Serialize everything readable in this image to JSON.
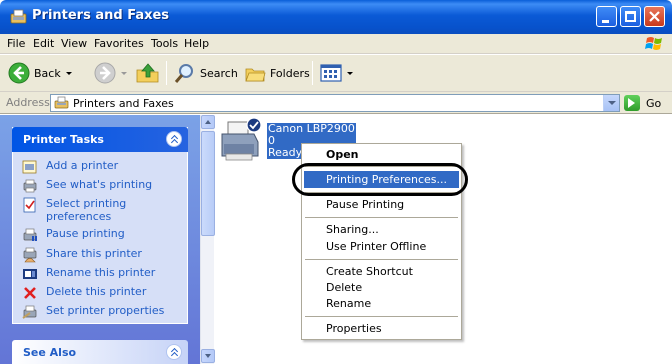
{
  "window": {
    "title": "Printers and Faxes"
  },
  "menubar": {
    "items": [
      "File",
      "Edit",
      "View",
      "Favorites",
      "Tools",
      "Help"
    ]
  },
  "toolbar": {
    "back_label": "Back",
    "search_label": "Search",
    "folders_label": "Folders"
  },
  "address": {
    "label": "Address",
    "value": "Printers and Faxes",
    "go_label": "Go"
  },
  "tasks": {
    "title": "Printer Tasks",
    "items": [
      {
        "label": "Add a printer",
        "icon": "add-printer-icon"
      },
      {
        "label": "See what's printing",
        "icon": "print-queue-icon"
      },
      {
        "label": "Select printing preferences",
        "icon": "preferences-icon"
      },
      {
        "label": "Pause printing",
        "icon": "pause-printer-icon"
      },
      {
        "label": "Share this printer",
        "icon": "share-printer-icon"
      },
      {
        "label": "Rename this printer",
        "icon": "rename-icon"
      },
      {
        "label": "Delete this printer",
        "icon": "delete-icon"
      },
      {
        "label": "Set printer properties",
        "icon": "properties-icon"
      }
    ],
    "see_also_title": "See Also"
  },
  "printer": {
    "name": "Canon LBP2900",
    "docs": "0",
    "status": "Ready"
  },
  "context_menu": {
    "items": [
      {
        "label": "Open",
        "bold": true
      },
      {
        "label": "Printing Preferences...",
        "selected": true
      },
      {
        "label": "Pause Printing"
      },
      {
        "label": "Sharing..."
      },
      {
        "label": "Use Printer Offline"
      },
      {
        "label": "Create Shortcut"
      },
      {
        "label": "Delete"
      },
      {
        "label": "Rename"
      },
      {
        "label": "Properties"
      }
    ]
  },
  "colors": {
    "titlebar": "#0a5fd8",
    "selection": "#316ac5",
    "task_link": "#215dc6",
    "task_pane": "#6375d6"
  }
}
